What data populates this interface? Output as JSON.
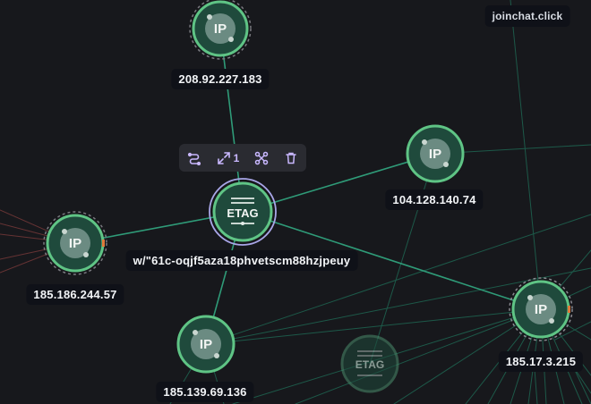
{
  "toolbar": {
    "expand_count": "1"
  },
  "nodes": [
    {
      "id": "n1",
      "type": "IP",
      "badge": "IP",
      "label": "208.92.227.183"
    },
    {
      "id": "n2",
      "type": "IP",
      "badge": "IP",
      "label": "104.128.140.74"
    },
    {
      "id": "n3",
      "type": "ETAG",
      "badge": "ETAG",
      "label": "w/\"61c-oqjf5aza18phvetscm88hzjpeuy"
    },
    {
      "id": "n4",
      "type": "IP",
      "badge": "IP",
      "label": "185.186.244.57"
    },
    {
      "id": "n5",
      "type": "IP",
      "badge": "IP",
      "label": "185.139.69.136"
    },
    {
      "id": "n6",
      "type": "ETAG",
      "badge": "ETAG",
      "label": ""
    },
    {
      "id": "n7",
      "type": "IP",
      "badge": "IP",
      "label": "185.17.3.215"
    }
  ],
  "top_right_label": "joinchat.click",
  "colors": {
    "background": "#17181c",
    "node_fill": "#1f4a3c",
    "node_ring": "#5fc485",
    "edge": "#2f9b78",
    "selected_ring": "#a9a6e8",
    "toolbar_icon": "#c9b8ff",
    "label_bg": "#0f1118"
  }
}
